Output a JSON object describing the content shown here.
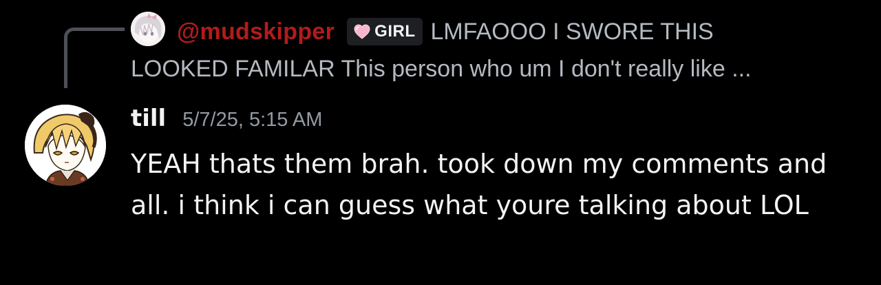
{
  "reply": {
    "username": "@mudskipper",
    "tag": {
      "label": "GIRL",
      "icon": "heart-icon"
    },
    "text_line1": "LMFAOOO I SWORE THIS",
    "text_line2": "LOOKED FAMILAR This person who um I don't really like ...",
    "avatar_icon": "anime-avatar"
  },
  "message": {
    "author": "till",
    "timestamp": "5/7/25, 5:15 AM",
    "body": "YEAH thats them brah. took down my comments and all. i think i can guess what youre talking about LOL",
    "avatar_icon": "anime-avatar"
  },
  "colors": {
    "background": "#000000",
    "reply_username": "#b31b1b",
    "reply_text": "#b5bac1",
    "author_name": "#f2f3f5",
    "timestamp": "#949ba4",
    "body_text": "#f2f3f5",
    "tag_background": "#1e1f22",
    "spine": "#4e5058"
  }
}
